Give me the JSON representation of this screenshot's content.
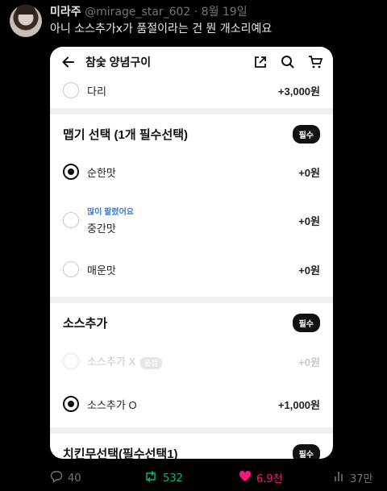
{
  "tweet": {
    "display_name": "미라주",
    "handle": "@mirage_star_602",
    "separator": "·",
    "date": "8월 19일",
    "text": "아니 소스추가x가 품절이라는 건 뭔 개소리예요"
  },
  "app": {
    "title": "참숯 양념구이",
    "icons": [
      "back-arrow-icon",
      "share-icon",
      "search-icon",
      "cart-icon"
    ],
    "top_option": {
      "label": "다리",
      "price": "+3,000원"
    },
    "sections": [
      {
        "title": "맵기 선택 (1개 필수선택)",
        "badge": "필수",
        "options": [
          {
            "label": "순한맛",
            "price": "+0원",
            "selected": true
          },
          {
            "label": "중간맛",
            "price": "+0원",
            "selected": false,
            "tag": "많이 팔렸어요"
          },
          {
            "label": "매운맛",
            "price": "+0원",
            "selected": false
          }
        ]
      },
      {
        "title": "소스추가",
        "badge": "필수",
        "options": [
          {
            "label": "소스추가 X",
            "price": "+0원",
            "disabled": true,
            "soldout_label": "품절"
          },
          {
            "label": "소스추가 O",
            "price": "+1,000원",
            "selected": true
          }
        ]
      },
      {
        "title": "치킨무선택(필수선택1)",
        "badge": "필수"
      }
    ]
  },
  "actions": {
    "replies": "40",
    "retweets": "532",
    "likes": "6.9천",
    "views": "37만",
    "retweet_color": "#00ba7c",
    "like_color": "#f91880"
  }
}
